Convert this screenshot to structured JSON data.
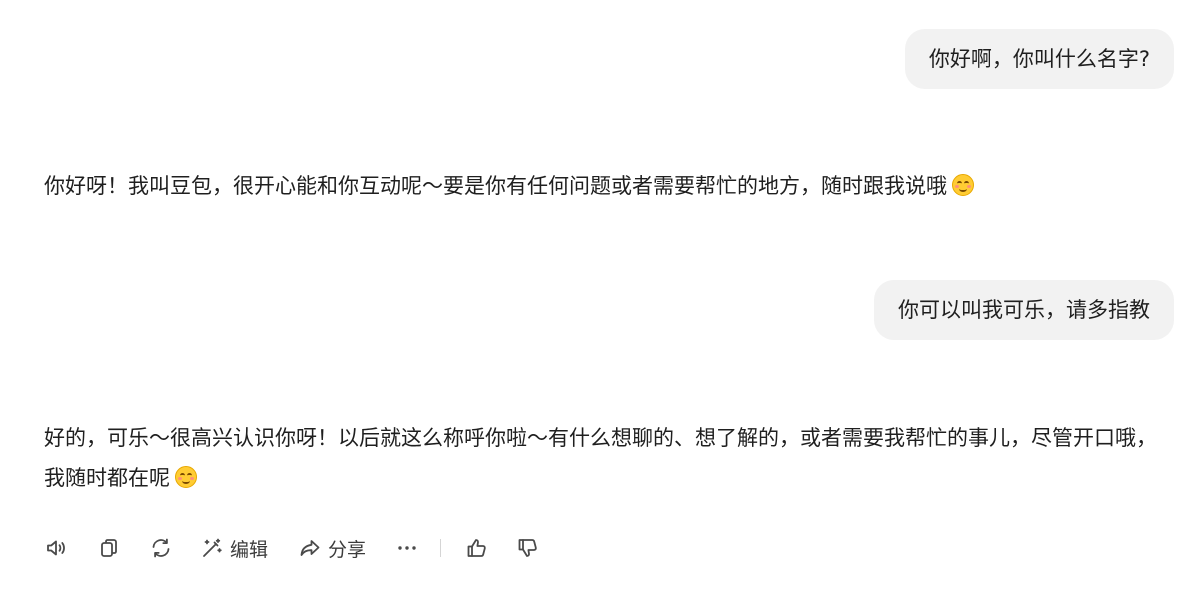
{
  "messages": [
    {
      "role": "user",
      "text": "你好啊，你叫什么名字?"
    },
    {
      "role": "assistant",
      "text": "你好呀！我叫豆包，很开心能和你互动呢～要是你有任何问题或者需要帮忙的地方，随时跟我说哦",
      "emoji": "smiling-face-emoji"
    },
    {
      "role": "user",
      "text": "你可以叫我可乐，请多指教"
    },
    {
      "role": "assistant",
      "text": "好的，可乐～很高兴认识你呀！以后就这么称呼你啦～有什么想聊的、想了解的，或者需要我帮忙的事儿，尽管开口哦，我随时都在呢",
      "emoji": "smiling-face-emoji"
    }
  ],
  "toolbar": {
    "speaker_icon": "speaker-icon",
    "copy_icon": "copy-icon",
    "regenerate_icon": "regenerate-icon",
    "edit_icon": "magic-wand-edit-icon",
    "edit_label": "编辑",
    "share_icon": "share-arrow-icon",
    "share_label": "分享",
    "more_icon": "more-dots-icon",
    "like_icon": "thumbs-up-icon",
    "dislike_icon": "thumbs-down-icon"
  },
  "colors": {
    "user_bubble_bg": "#f2f2f2",
    "text": "#1f1f1f",
    "icon": "#4a4a4a",
    "background": "#ffffff"
  }
}
